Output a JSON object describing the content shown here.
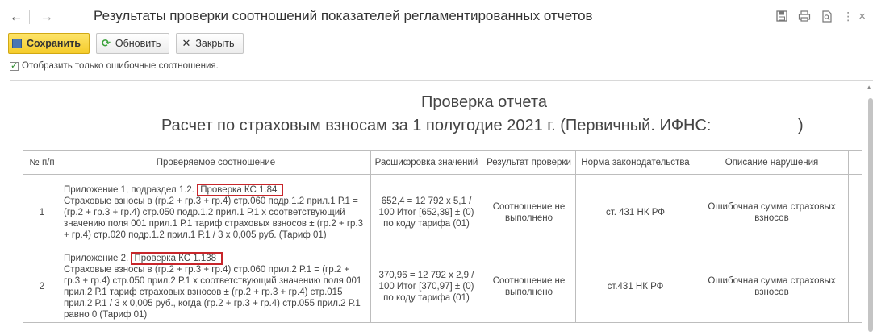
{
  "window": {
    "title": "Результаты проверки соотношений показателей регламентированных отчетов",
    "back_icon": "arrow-left-icon",
    "forward_icon": "arrow-right-icon"
  },
  "toolbar": {
    "save_label": "Сохранить",
    "refresh_label": "Обновить",
    "close_label": "Закрыть"
  },
  "filter": {
    "only_errors_label": "Отобразить только ошибочные соотношения.",
    "only_errors_checked": true
  },
  "report": {
    "title": "Проверка отчета",
    "subtitle": "Расчет по страховым взносам за 1 полугодие 2021 г. (Первичный. ИФНС:",
    "subtitle_close": ")"
  },
  "table": {
    "headers": {
      "num": "№ п/п",
      "relation": "Проверяемое соотношение",
      "decode": "Расшифровка значений",
      "result": "Результат проверки",
      "norm": "Норма законодательства",
      "violation": "Описание нарушения"
    },
    "rows": [
      {
        "num": "1",
        "relation_prefix": "Приложение 1, подраздел 1.2.",
        "check_code": "Проверка КС 1.84",
        "relation_text": "Страховые взносы в (гр.2 + гр.3 + гр.4) стр.060 подр.1.2 прил.1 Р.1 = (гр.2 + гр.3 + гр.4) стр.050 подр.1.2 прил.1 Р.1 х соответствующий значению поля 001 прил.1 Р.1 тариф страховых взносов ± (гр.2 + гр.3 + гр.4) стр.020 подр.1.2 прил.1 Р.1 / 3 х 0,005 руб. (Тариф 01)",
        "decode": "652,4 = 12 792 х 5,1 / 100 Итог [652,39] ± (0) по коду тарифа (01)",
        "result": "Соотношение не выполнено",
        "norm": "ст. 431 НК РФ",
        "violation": "Ошибочная сумма страховых взносов"
      },
      {
        "num": "2",
        "relation_prefix": "Приложение 2.",
        "check_code": "Проверка КС 1.138",
        "relation_text": "Страховые взносы в (гр.2 + гр.3 + гр.4) стр.060 прил.2 Р.1 = (гр.2 + гр.3 + гр.4) стр.050 прил.2 Р.1 х соответствующий значению поля 001 прил.2 Р.1 тариф страховых взносов ± (гр.2 + гр.3 + гр.4) стр.015 прил.2 Р.1 / 3 х 0,005 руб., когда (гр.2 + гр.3 + гр.4) стр.055 прил.2 Р.1 равно 0 (Тариф 01)",
        "decode": "370,96 = 12 792 х 2,9 / 100 Итог [370,97] ± (0) по коду тарифа (01)",
        "result": "Соотношение не выполнено",
        "norm": "ст.431 НК РФ",
        "violation": "Ошибочная сумма страховых взносов"
      }
    ]
  },
  "colors": {
    "error_text": "#c62828",
    "highlight_border": "#c8262b",
    "save_button": "#f5cc2a"
  }
}
